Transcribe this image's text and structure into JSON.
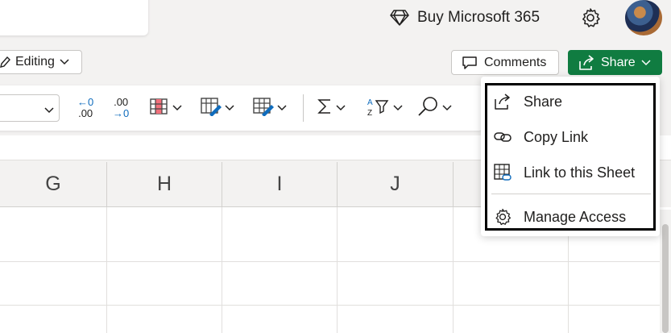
{
  "header": {
    "buy_label": "Buy Microsoft 365"
  },
  "toolbar": {
    "editing_label": "Editing",
    "comments_label": "Comments",
    "share_label": "Share"
  },
  "ribbon": {
    "decrease_decimal_top": "←0",
    "decrease_decimal_bottom": ".00",
    "increase_decimal_top": ".00",
    "increase_decimal_bottom": "→0"
  },
  "columns": [
    "G",
    "H",
    "I",
    "J"
  ],
  "share_menu": {
    "items": [
      {
        "label": "Share",
        "icon": "share-icon"
      },
      {
        "label": "Copy Link",
        "icon": "link-icon"
      },
      {
        "label": "Link to this Sheet",
        "icon": "sheet-link-icon"
      },
      {
        "label": "Manage Access",
        "icon": "gear-icon"
      }
    ]
  },
  "colors": {
    "share_green": "#107c41",
    "highlight_border": "#000000"
  }
}
